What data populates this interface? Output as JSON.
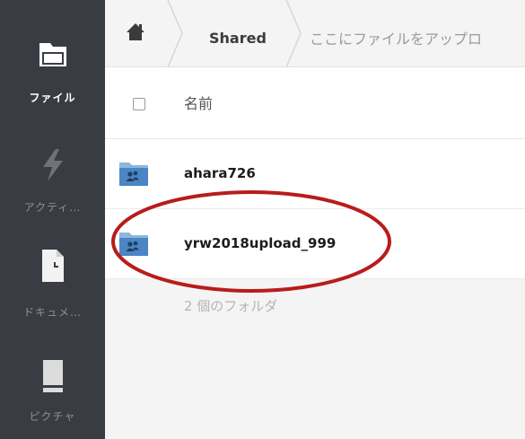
{
  "sidebar": {
    "items": [
      {
        "label": "ファイル",
        "icon": "folder-icon",
        "active": true
      },
      {
        "label": "アクティ…",
        "icon": "lightning-icon",
        "active": false
      },
      {
        "label": "ドキュメ…",
        "icon": "document-icon",
        "active": false
      },
      {
        "label": "ピクチャ",
        "icon": "picture-icon",
        "active": false
      }
    ]
  },
  "breadcrumb": {
    "home_icon": "home-icon",
    "current": "Shared",
    "upload_hint": "ここにファイルをアップロ"
  },
  "list": {
    "column_name": "名前",
    "rows": [
      {
        "name": "ahara726",
        "icon": "shared-folder-icon"
      },
      {
        "name": "yrw2018upload_999",
        "icon": "shared-folder-icon"
      }
    ],
    "summary": "2 個のフォルダ"
  },
  "colors": {
    "sidebar_bg": "#3a3c44",
    "folder_blue": "#4a86c4",
    "highlight_red": "#b81c1c"
  }
}
